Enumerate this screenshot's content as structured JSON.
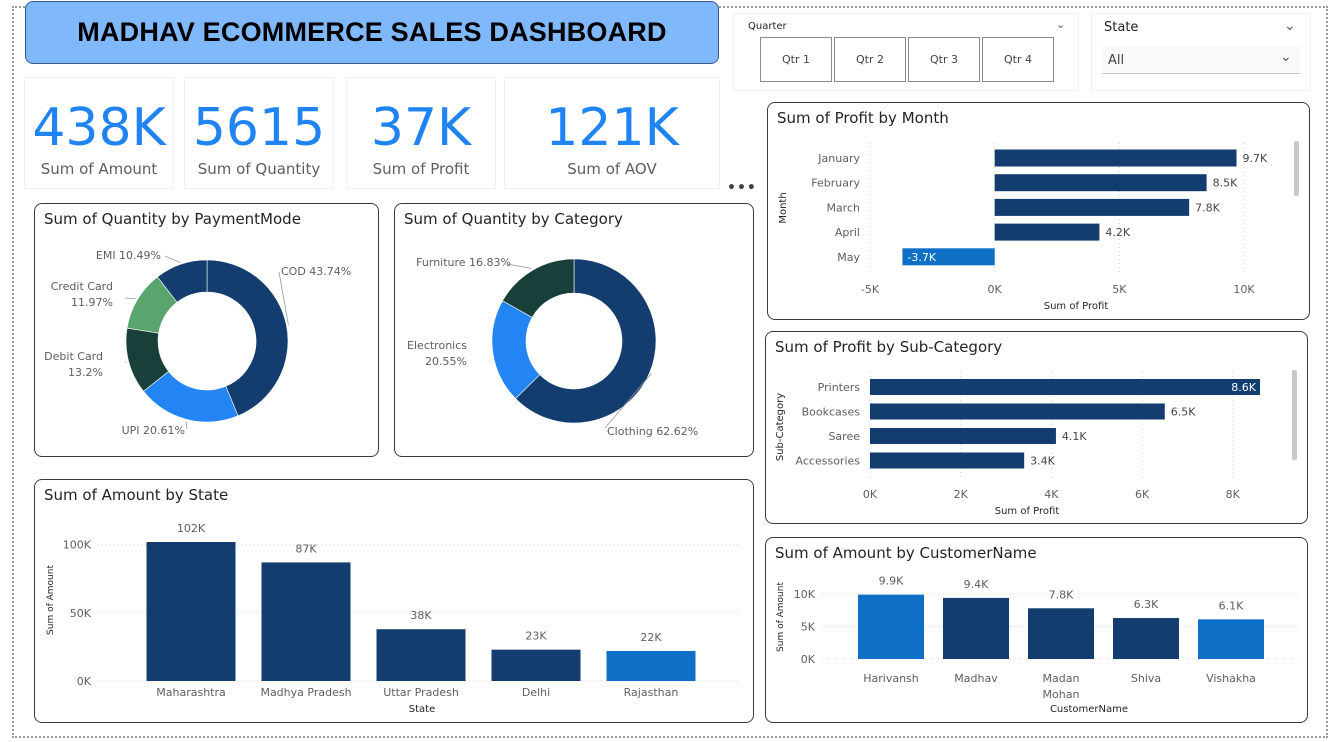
{
  "header": {
    "title": "MADHAV ECOMMERCE SALES DASHBOARD"
  },
  "kpis": [
    {
      "value": "438K",
      "label": "Sum of Amount"
    },
    {
      "value": "5615",
      "label": "Sum of Quantity"
    },
    {
      "value": "37K",
      "label": "Sum of Profit"
    },
    {
      "value": "121K",
      "label": "Sum of AOV"
    }
  ],
  "quarter_slicer": {
    "label": "Quarter",
    "options": [
      "Qtr 1",
      "Qtr 2",
      "Qtr 3",
      "Qtr 4"
    ]
  },
  "state_slicer": {
    "label": "State",
    "value": "All"
  },
  "colors": {
    "dark_blue": "#123d6e",
    "mid_blue": "#1f84f2",
    "light_blue": "#0f6fc6",
    "green": "#5aa56e",
    "dark_green": "#183f39",
    "title_bg": "#7fb8fb"
  },
  "chart_data": [
    {
      "id": "payment",
      "type": "pie",
      "title": "Sum of Quantity by PaymentMode",
      "slices": [
        {
          "label": "COD",
          "pct": 43.74,
          "text": "COD 43.74%",
          "color": "#123d6e"
        },
        {
          "label": "UPI",
          "pct": 20.61,
          "text": "UPI 20.61%",
          "color": "#2385f4"
        },
        {
          "label": "Debit Card",
          "pct": 13.2,
          "text": "Debit Card 13.2%",
          "color": "#183f39"
        },
        {
          "label": "Credit Card",
          "pct": 11.97,
          "text": "Credit Card 11.97%",
          "color": "#5aa56e"
        },
        {
          "label": "EMI",
          "pct": 10.49,
          "text": "EMI 10.49%",
          "color": "#123d6e"
        }
      ]
    },
    {
      "id": "category",
      "type": "pie",
      "title": "Sum of Quantity by Category",
      "slices": [
        {
          "label": "Clothing",
          "pct": 62.62,
          "text": "Clothing 62.62%",
          "color": "#123d6e"
        },
        {
          "label": "Electronics",
          "pct": 20.55,
          "text": "Electronics 20.55%",
          "color": "#2385f4"
        },
        {
          "label": "Furniture",
          "pct": 16.83,
          "text": "Furniture 16.83%",
          "color": "#183f39"
        }
      ]
    },
    {
      "id": "profit_month",
      "type": "bar",
      "title": "Sum of Profit by Month",
      "xlabel": "Sum of Profit",
      "ylabel": "Month",
      "categories": [
        "January",
        "February",
        "March",
        "April",
        "May"
      ],
      "values": [
        9700,
        8500,
        7800,
        4200,
        -3700
      ],
      "labels": [
        "9.7K",
        "8.5K",
        "7.8K",
        "4.2K",
        "-3.7K"
      ],
      "ticks": [
        -5000,
        0,
        5000,
        10000
      ],
      "tick_labels": [
        "-5K",
        "0K",
        "5K",
        "10K"
      ],
      "xlim": [
        -5000,
        10000
      ]
    },
    {
      "id": "profit_subcat",
      "type": "bar",
      "title": "Sum of Profit by Sub-Category",
      "xlabel": "Sum of Profit",
      "ylabel": "Sub-Category",
      "categories": [
        "Printers",
        "Bookcases",
        "Saree",
        "Accessories"
      ],
      "values": [
        8600,
        6500,
        4100,
        3400
      ],
      "labels": [
        "8.6K",
        "6.5K",
        "4.1K",
        "3.4K"
      ],
      "ticks": [
        0,
        2000,
        4000,
        6000,
        8000
      ],
      "tick_labels": [
        "0K",
        "2K",
        "4K",
        "6K",
        "8K"
      ],
      "xlim": [
        0,
        8600
      ]
    },
    {
      "id": "amount_state",
      "type": "bar",
      "title": "Sum of Amount by State",
      "xlabel": "State",
      "ylabel": "Sum of Amount",
      "categories": [
        "Maharashtra",
        "Madhya Pradesh",
        "Uttar Pradesh",
        "Delhi",
        "Rajasthan"
      ],
      "values": [
        102000,
        87000,
        38000,
        23000,
        22000
      ],
      "labels": [
        "102K",
        "87K",
        "38K",
        "23K",
        "22K"
      ],
      "ticks": [
        0,
        50000,
        100000
      ],
      "tick_labels": [
        "0K",
        "50K",
        "100K"
      ],
      "ylim": [
        0,
        102000
      ]
    },
    {
      "id": "amount_customer",
      "type": "bar",
      "title": "Sum of Amount by CustomerName",
      "xlabel": "CustomerName",
      "ylabel": "Sum of Amount",
      "categories": [
        "Harivansh",
        "Madhav",
        "Madan Mohan",
        "Shiva",
        "Vishakha"
      ],
      "category_lines": [
        [
          "Harivansh"
        ],
        [
          "Madhav"
        ],
        [
          "Madan",
          "Mohan"
        ],
        [
          "Shiva"
        ],
        [
          "Vishakha"
        ]
      ],
      "values": [
        9900,
        9400,
        7800,
        6300,
        6100
      ],
      "labels": [
        "9.9K",
        "9.4K",
        "7.8K",
        "6.3K",
        "6.1K"
      ],
      "ticks": [
        0,
        5000,
        10000
      ],
      "tick_labels": [
        "0K",
        "5K",
        "10K"
      ],
      "ylim": [
        0,
        10000
      ]
    }
  ]
}
